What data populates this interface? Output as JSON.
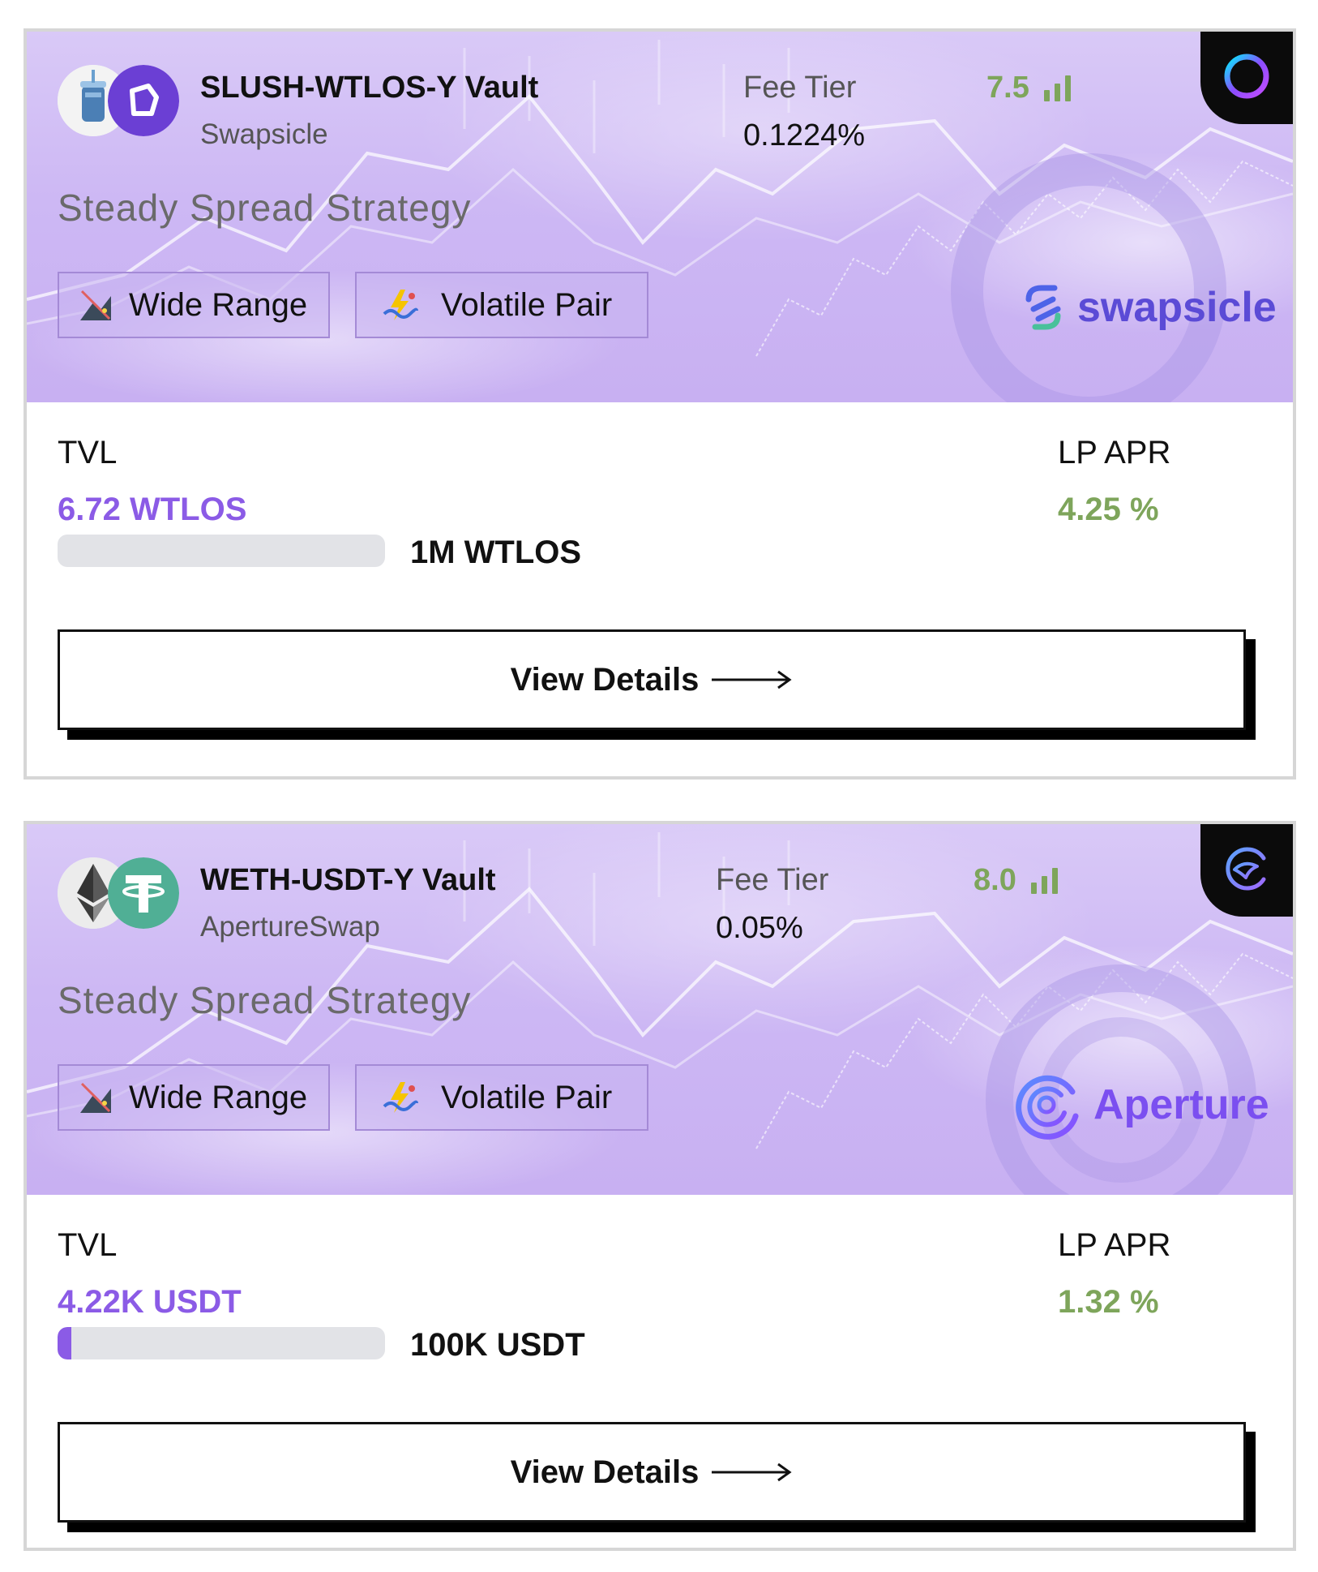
{
  "vaults": [
    {
      "name": "SLUSH-WTLOS-Y Vault",
      "protocol": "Swapsicle",
      "fee_label": "Fee Tier",
      "fee_value": "0.1224%",
      "score": "7.5",
      "strategy": "Steady Spread Strategy",
      "tags": [
        "Wide Range",
        "Volatile Pair"
      ],
      "brand": "swapsicle",
      "tvl_label": "TVL",
      "tvl_value": "6.72 WTLOS",
      "tvl_cap": "1M WTLOS",
      "tvl_progress": 0.0,
      "apr_label": "LP APR",
      "apr_value": "4.25 %",
      "button": "View Details",
      "token_icons": [
        "slush-token-icon",
        "wtlos-token-icon"
      ],
      "corner_icon": "telos-ring-icon"
    },
    {
      "name": "WETH-USDT-Y Vault",
      "protocol": "ApertureSwap",
      "fee_label": "Fee Tier",
      "fee_value": "0.05%",
      "score": "8.0",
      "strategy": "Steady Spread Strategy",
      "tags": [
        "Wide Range",
        "Volatile Pair"
      ],
      "brand": "Aperture",
      "tvl_label": "TVL",
      "tvl_value": "4.22K USDT",
      "tvl_cap": "100K USDT",
      "tvl_progress": 0.0422,
      "apr_label": "LP APR",
      "apr_value": "1.32 %",
      "button": "View Details",
      "token_icons": [
        "ethereum-token-icon",
        "tether-token-icon"
      ],
      "corner_icon": "aperture-bird-icon"
    }
  ],
  "colors": {
    "accent_purple": "#8b5be6",
    "score_green": "#7ea55b",
    "hero_bg": "#cdb8f4",
    "progress_track": "#e2e3e7"
  }
}
